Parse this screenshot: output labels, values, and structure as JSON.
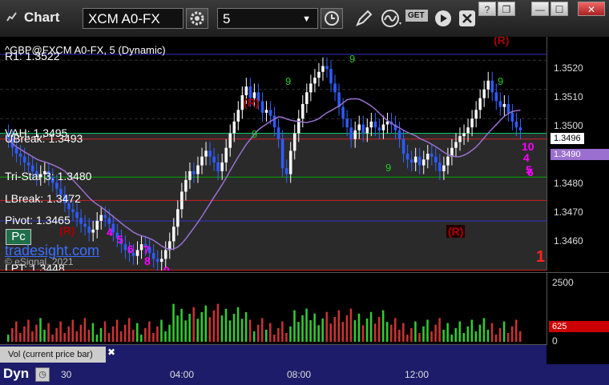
{
  "app": {
    "title": "Chart"
  },
  "toolbar": {
    "symbol": "XCM A0-FX",
    "interval": "5",
    "get_label": "GET"
  },
  "window_controls": {
    "help": "?",
    "restore": "❐",
    "minimize": "—",
    "maximize": "☐",
    "close": "✕"
  },
  "chart": {
    "header": "^GBP@FXCM A0-FX, 5 (Dynamic)",
    "levels": [
      {
        "name": "R1",
        "label": "R1: 1.3522",
        "price": 1.3522,
        "color": "#3333cc"
      },
      {
        "name": "VAH",
        "label": "VAH: 1.3495",
        "price": 1.3495,
        "color": "#00cc66"
      },
      {
        "name": "UBreak",
        "label": "UBreak: 1.3493",
        "price": 1.3493,
        "color": "#cc2222"
      },
      {
        "name": "TriStar",
        "label": "Tri-Star 3: 1.3480",
        "price": 1.348,
        "color": "#00aa00"
      },
      {
        "name": "LBreak",
        "label": "LBreak: 1.3472",
        "price": 1.3472,
        "color": "#cc2222"
      },
      {
        "name": "Pivot",
        "label": "Pivot: 1.3465",
        "price": 1.3465,
        "color": "#3333cc"
      },
      {
        "name": "LPT",
        "label": "LPT: 1.3448",
        "price": 1.3448,
        "color": "#cc2222"
      }
    ],
    "pc_label": "Pc",
    "watermark": "tradesight.com",
    "copyright": "© eSignal, 2021",
    "price_ticks": [
      "1.3520",
      "1.3510",
      "1.3500",
      "1.3490",
      "1.3480",
      "1.3470",
      "1.3460"
    ],
    "last_price": "1.3496",
    "vwap_price": "1.3490",
    "r_markers": [
      "(R)",
      "(R)",
      "(R)",
      "(R)"
    ],
    "countdown_labels": [
      "9",
      "9",
      "9",
      "9",
      "9",
      "4",
      "5",
      "6",
      "7",
      "8",
      "9",
      "10",
      "4",
      "5",
      "6"
    ],
    "big_number": "1",
    "vol_label": "Vol (current price bar)",
    "vol_ticks": [
      "2500",
      "0"
    ],
    "vol_last": "625",
    "time_ticks": [
      "30",
      "04:00",
      "08:00",
      "12:00"
    ],
    "dyn_label": "Dyn"
  },
  "chart_data": {
    "type": "candlestick",
    "title": "^GBP@FXCM A0-FX, 5 (Dynamic)",
    "ylim": [
      1.3448,
      1.3528
    ],
    "closes": [
      1.3493,
      1.349,
      1.3488,
      1.3487,
      1.3485,
      1.3484,
      1.3482,
      1.348,
      1.3481,
      1.3482,
      1.348,
      1.3478,
      1.3476,
      1.3474,
      1.3471,
      1.3469,
      1.3468,
      1.3466,
      1.3464,
      1.3463,
      1.3461,
      1.3462,
      1.3465,
      1.3467,
      1.3466,
      1.3464,
      1.3461,
      1.3459,
      1.3457,
      1.3455,
      1.3454,
      1.3453,
      1.3455,
      1.3457,
      1.3456,
      1.3454,
      1.3452,
      1.3451,
      1.3452,
      1.3455,
      1.3458,
      1.3463,
      1.3469,
      1.3475,
      1.3479,
      1.3482,
      1.3481,
      1.3484,
      1.3487,
      1.3489,
      1.3487,
      1.3485,
      1.3482,
      1.3485,
      1.349,
      1.3495,
      1.3499,
      1.3503,
      1.3508,
      1.3511,
      1.3507,
      1.3509,
      1.3506,
      1.3502,
      1.3503,
      1.3501,
      1.3497,
      1.3493,
      1.3483,
      1.3481,
      1.3489,
      1.3495,
      1.35,
      1.3505,
      1.3509,
      1.3512,
      1.3514,
      1.3516,
      1.3518,
      1.3517,
      1.3512,
      1.3509,
      1.3504,
      1.35,
      1.3497,
      1.3493,
      1.3496,
      1.3498,
      1.3495,
      1.3497,
      1.3499,
      1.3497,
      1.3496,
      1.3498,
      1.3499,
      1.3498,
      1.3496,
      1.3493,
      1.3488,
      1.3486,
      1.3485,
      1.3487,
      1.3484,
      1.3486,
      1.3488,
      1.3487,
      1.3485,
      1.3482,
      1.3484,
      1.3487,
      1.349,
      1.3492,
      1.3494,
      1.3495,
      1.3497,
      1.35,
      1.3503,
      1.3507,
      1.351,
      1.3513,
      1.3509,
      1.3506,
      1.3504,
      1.3505,
      1.3502,
      1.3499,
      1.3497,
      1.3496
    ],
    "volume_max": 2500,
    "volume_last": 625
  }
}
